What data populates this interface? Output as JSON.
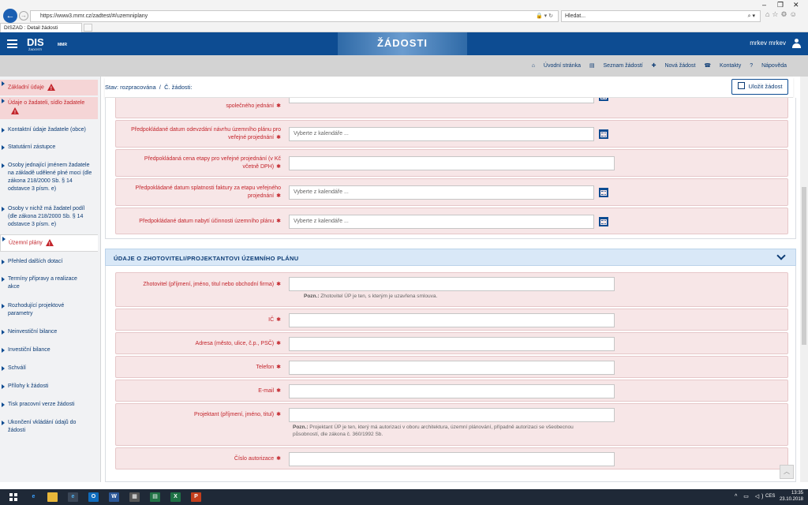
{
  "browser": {
    "url": "https://www3.mmr.cz/zadtest/#/uzemniplany",
    "search_placeholder": "Hledat...",
    "tab_title": "DISZAD : Detail žádosti"
  },
  "app": {
    "logo_text": "DIS",
    "logo_sub": "ŽADOSTI",
    "logo_mmr": "MMR",
    "banner_title": "ŽÁDOSTI",
    "user": "mrkev mrkev"
  },
  "topnav": {
    "items": [
      "Úvodní stránka",
      "Seznam žádostí",
      "Nová žádost",
      "Kontakty",
      "Nápověda"
    ]
  },
  "sidebar": {
    "items": [
      {
        "label": "Základní údaje"
      },
      {
        "label": "Údaje o žadateli, sídlo žadatele"
      },
      {
        "label": "Kontaktní údaje žadatele (obce)"
      },
      {
        "label": "Statutární zástupce"
      },
      {
        "label": "Osoby jednající jménem žadatele na základě udělené plné moci (dle zákona 218/2000 Sb. § 14 odstavce 3 písm. e)"
      },
      {
        "label": "Osoby v nichž má žadatel podíl (dle zákona 218/2000 Sb. § 14 odstavce 3 písm. e)"
      },
      {
        "label": "Územní plány"
      },
      {
        "label": "Přehled dalších dotací"
      },
      {
        "label": "Termíny přípravy a realizace akce"
      },
      {
        "label": "Rozhodující projektové parametry"
      },
      {
        "label": "Neinvestiční bilance"
      },
      {
        "label": "Investiční bilance"
      },
      {
        "label": "Schválí"
      },
      {
        "label": "Přílohy k žádosti"
      },
      {
        "label": "Tisk pracovní verze žádosti"
      },
      {
        "label": "Ukončení vkládání údajů do žádosti"
      }
    ]
  },
  "breadcrumb": {
    "stav": "Stav: rozpracována",
    "sep": "/",
    "cislo": "Č. žádosti:"
  },
  "save_label": "Uložit žádost",
  "section1": {
    "partial_label": "společného jednání",
    "rows": [
      {
        "label": "Předpokládané datum odevzdání návrhu územního plánu pro veřejné projednání",
        "placeholder": "Vyberte z kalendáře ..."
      },
      {
        "label": "Předpokládaná cena etapy pro veřejné projednání (v Kč včetně DPH)",
        "placeholder": ""
      },
      {
        "label": "Předpokládané datum splatnosti faktury za etapu veřejného projednání",
        "placeholder": "Vyberte z kalendáře ..."
      },
      {
        "label": "Předpokládané datum nabytí účinnosti územního plánu",
        "placeholder": "Vyberte z kalendáře ..."
      }
    ]
  },
  "section2": {
    "title": "ÚDAJE O ZHOTOVITELI/PROJEKTANTOVI ÚZEMNÍHO PLÁNU",
    "rows": [
      {
        "label": "Zhotovitel (příjmení, jméno, titul nebo obchodní firma)",
        "note_bold": "Pozn.:",
        "note": " Zhotovitel ÚP je ten, s kterým je uzavřena smlouva."
      },
      {
        "label": "IČ"
      },
      {
        "label": "Adresa (město, ulice, č.p., PSČ)"
      },
      {
        "label": "Telefon"
      },
      {
        "label": "E-mail"
      },
      {
        "label": "Projektant (příjmení, jméno, titul)",
        "note_bold": "Pozn.:",
        "note": " Projektant ÚP je ten, který má autorizaci v oboru architektura, územní plánování, případně autorizaci se všeobecnou působností, dle zákona č. 360/1992 Sb."
      },
      {
        "label": "Číslo autorizace"
      }
    ]
  },
  "taskbar": {
    "time": "13:35",
    "date": "23.10.2018",
    "lang": "CES"
  }
}
